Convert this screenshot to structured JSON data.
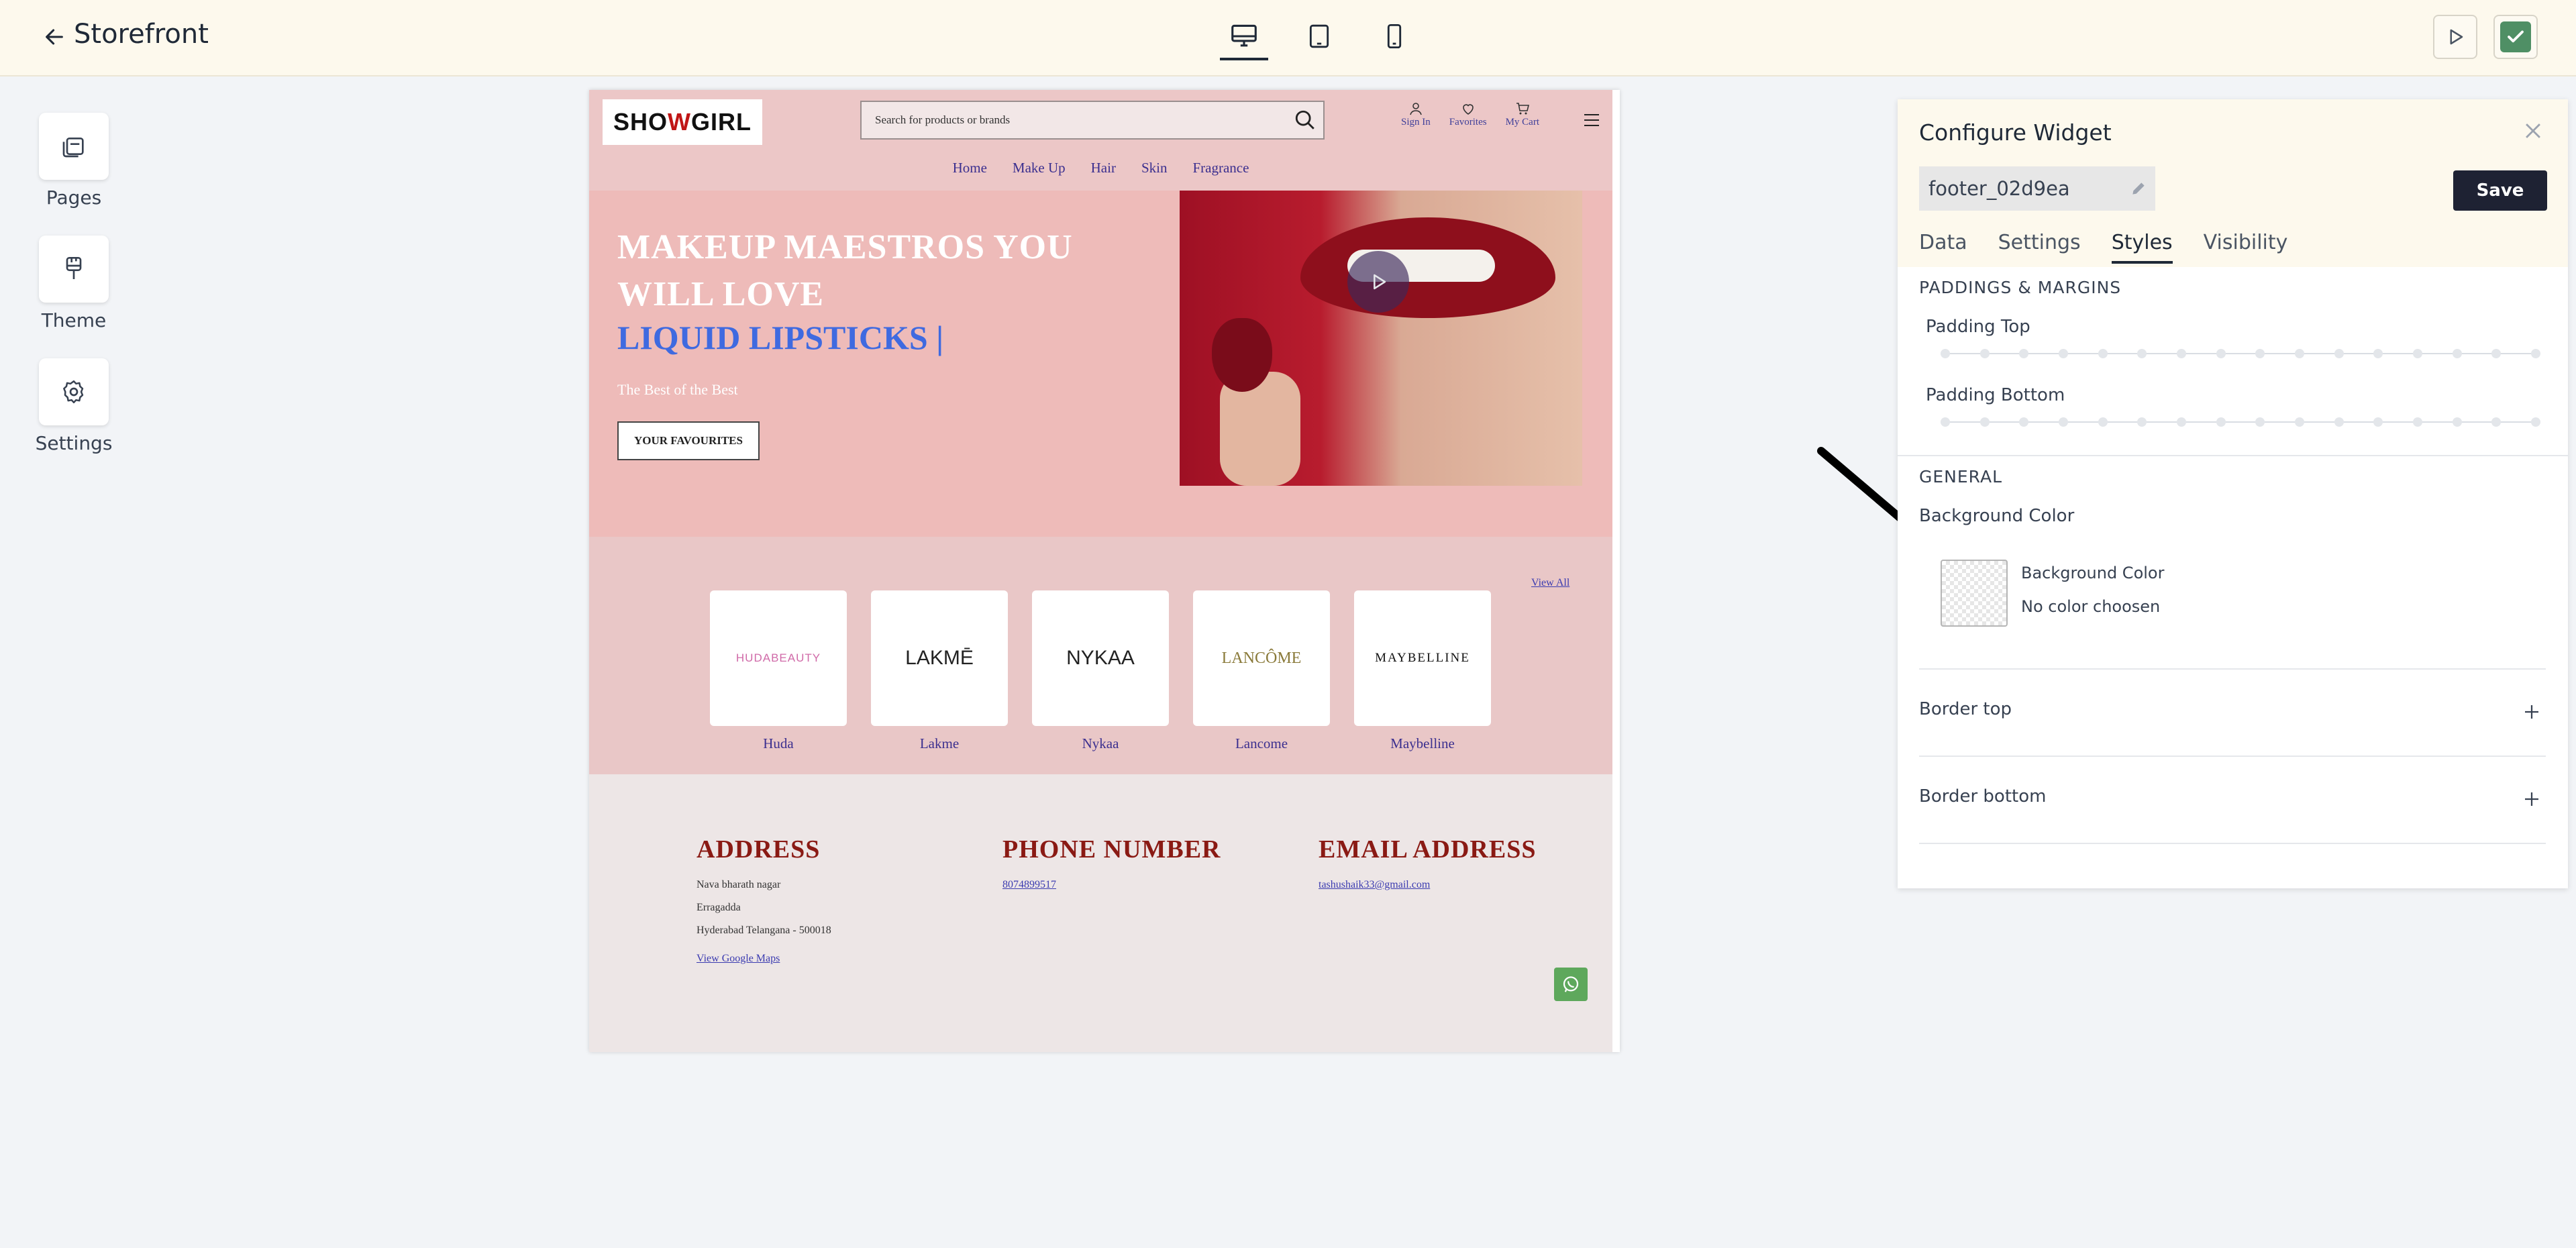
{
  "app": {
    "title": "Storefront"
  },
  "sidenav": [
    {
      "label": "Pages",
      "icon": "pages-icon"
    },
    {
      "label": "Theme",
      "icon": "brush-icon"
    },
    {
      "label": "Settings",
      "icon": "gear-icon"
    }
  ],
  "preview": {
    "logo": {
      "a": "SHO",
      "b": "W",
      "c": " GIRL"
    },
    "search_placeholder": "Search for products or brands",
    "header_icons": [
      "Sign In",
      "Favorites",
      "My Cart"
    ],
    "nav": [
      "Home",
      "Make Up",
      "Hair",
      "Skin",
      "Fragrance"
    ],
    "hero": {
      "line1": "MAKEUP MAESTROS YOU",
      "line2": "WILL LOVE",
      "line3": "LIQUID LIPSTICKS |",
      "subtitle": "The Best of the Best",
      "button": "YOUR FAVOURITES"
    },
    "brands": {
      "view_all": "View All",
      "items": [
        {
          "name": "Huda",
          "logo": "HUDABEAUTY"
        },
        {
          "name": "Lakme",
          "logo": "LAKMĒ"
        },
        {
          "name": "Nykaa",
          "logo": "NYKAA"
        },
        {
          "name": "Lancome",
          "logo": "LANCÔME"
        },
        {
          "name": "Maybelline",
          "logo": "MAYBELLINE"
        }
      ]
    },
    "footer": {
      "address_heading": "ADDRESS",
      "address_lines": [
        "Nava bharath nagar",
        "Erragadda",
        "Hyderabad Telangana - 500018"
      ],
      "maps_link": "View Google Maps",
      "phone_heading": "PHONE NUMBER",
      "phone": "8074899517",
      "email_heading": "EMAIL ADDRESS",
      "email": "tashushaik33@gmail.com"
    }
  },
  "panel": {
    "title": "Configure Widget",
    "widget_name": "footer_02d9ea",
    "save": "Save",
    "tabs": [
      "Data",
      "Settings",
      "Styles",
      "Visibility"
    ],
    "active_tab": "Styles",
    "paddings_heading": "PADDINGS & MARGINS",
    "padding_top": "Padding Top",
    "padding_bottom": "Padding Bottom",
    "general_heading": "GENERAL",
    "bg_color_label": "Background Color",
    "bg_color_title": "Background Color",
    "bg_color_value": "No color choosen",
    "border_top": "Border top",
    "border_bottom": "Border bottom"
  },
  "colors": {
    "accent": "#1e2233",
    "confirm": "#4f8f65",
    "hero_bg": "#eebbb9",
    "hero_highlight": "#3f6ae0",
    "footer_heading": "#8a1a14"
  }
}
